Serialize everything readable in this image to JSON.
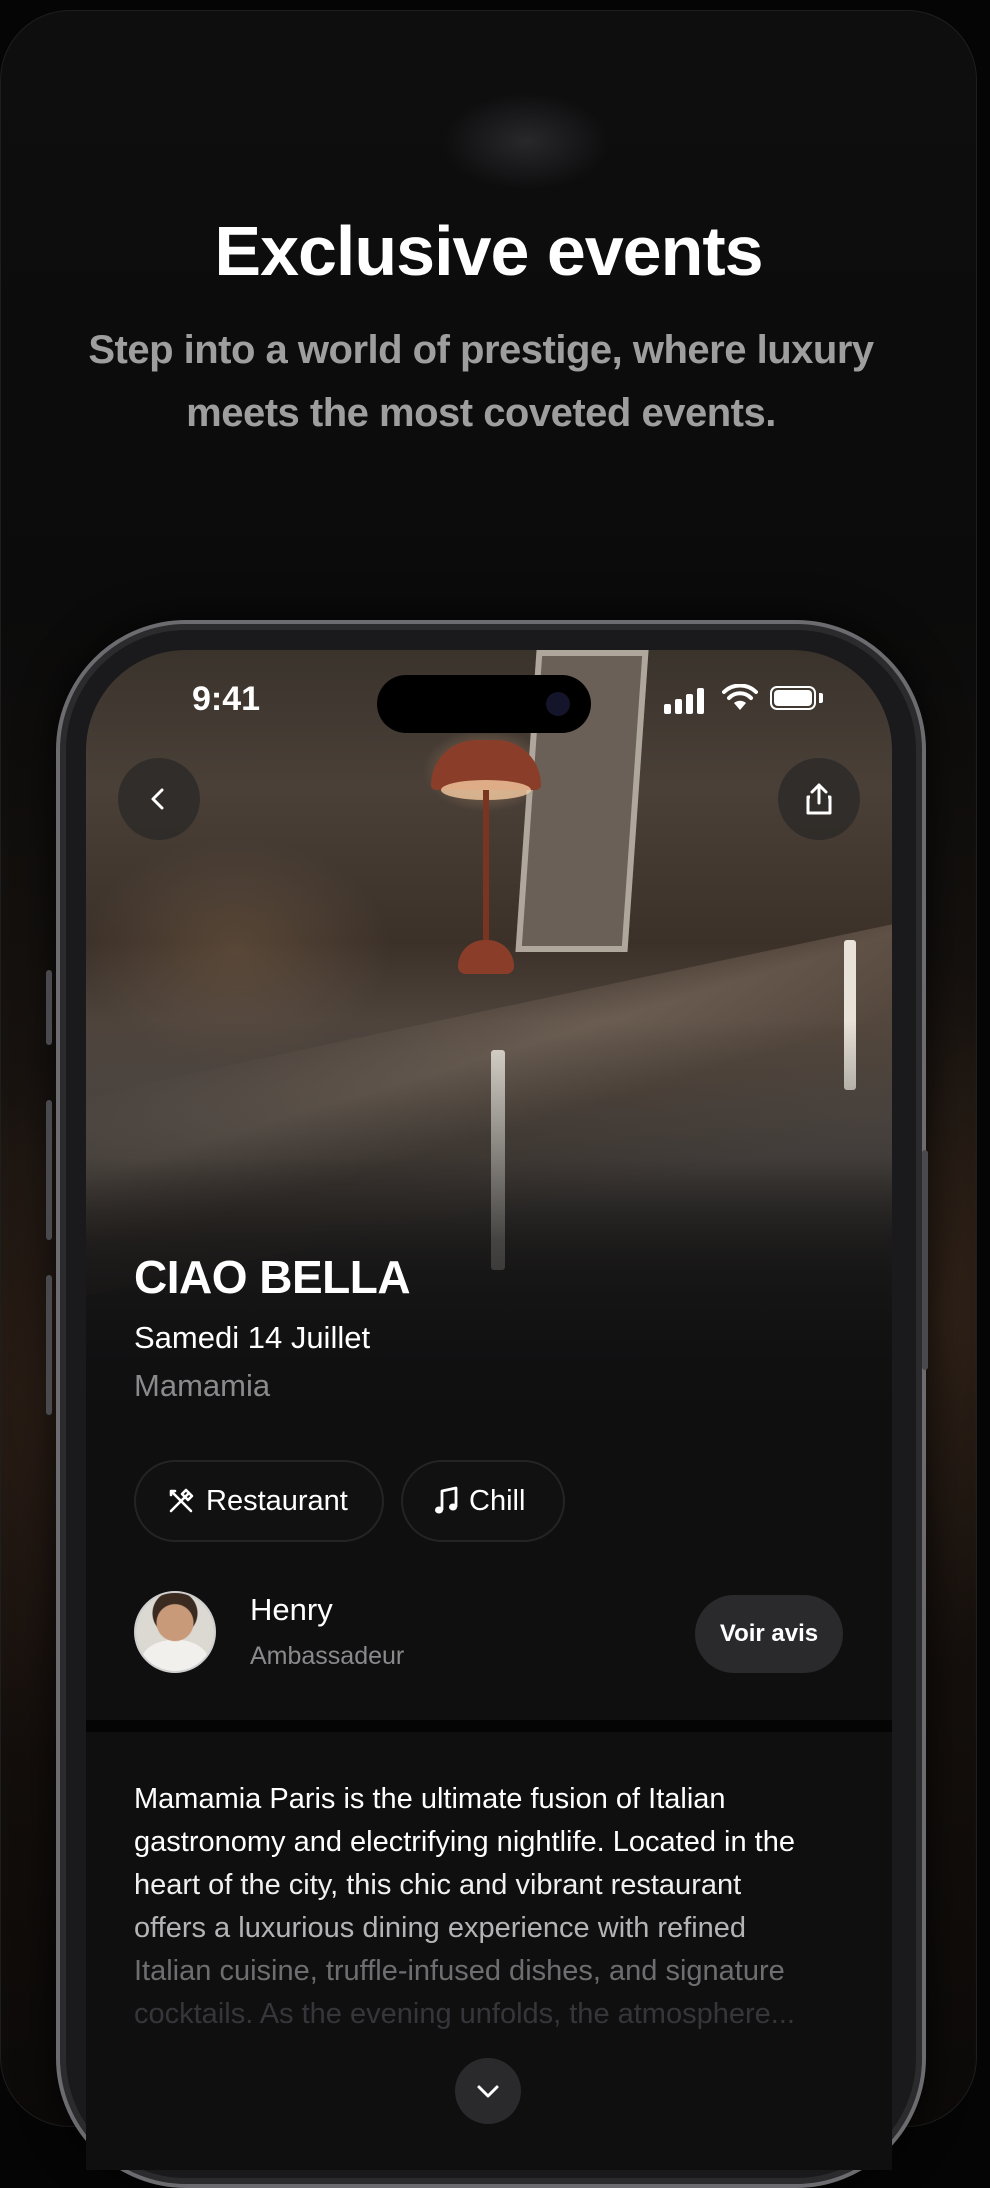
{
  "promo": {
    "headline": "Exclusive events",
    "subline": "Step into a world of prestige, where luxury meets the most coveted events."
  },
  "status_bar": {
    "time": "9:41"
  },
  "event": {
    "title": "CIAO BELLA",
    "date": "Samedi 14 Juillet",
    "venue": "Mamamia"
  },
  "tags": [
    {
      "label": "Restaurant",
      "icon": "utensils-icon"
    },
    {
      "label": "Chill",
      "icon": "music-note-icon"
    }
  ],
  "ambassador": {
    "name": "Henry",
    "role": "Ambassadeur",
    "action_label": "Voir avis"
  },
  "description": {
    "lines": [
      "Mamamia Paris is the ultimate fusion of Italian",
      "gastronomy and electrifying nightlife. Located in the",
      "heart of the city, this chic and vibrant restaurant",
      "offers a luxurious dining experience with refined",
      "Italian cuisine, truffle-infused dishes, and signature",
      "cocktails. As the evening unfolds, the atmosphere..."
    ]
  },
  "icons": {
    "back": "chevron-left-icon",
    "share": "share-icon",
    "expand": "chevron-down-icon"
  }
}
